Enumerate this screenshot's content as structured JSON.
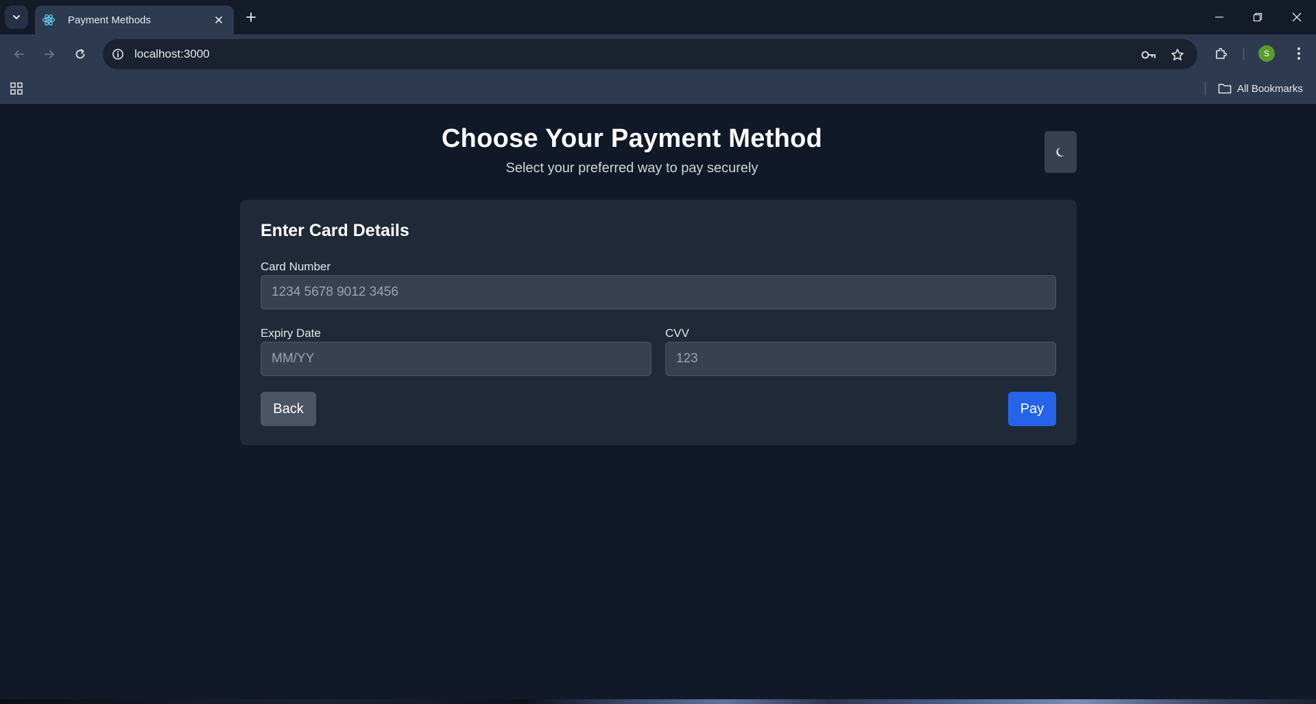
{
  "browser": {
    "tab_title": "Payment Methods",
    "url": "localhost:3000",
    "profile_initial": "S",
    "bookmarks_label": "All Bookmarks"
  },
  "page": {
    "title": "Choose Your Payment Method",
    "subtitle": "Select your preferred way to pay securely",
    "theme_toggle_icon": "moon-icon"
  },
  "card_form": {
    "heading": "Enter Card Details",
    "card_number": {
      "label": "Card Number",
      "placeholder": "1234 5678 9012 3456",
      "value": ""
    },
    "expiry": {
      "label": "Expiry Date",
      "placeholder": "MM/YY",
      "value": ""
    },
    "cvv": {
      "label": "CVV",
      "placeholder": "123",
      "value": ""
    },
    "back_label": "Back",
    "pay_label": "Pay"
  },
  "colors": {
    "page_bg": "#111827",
    "card_bg": "#1f2937",
    "input_bg": "#374151",
    "primary": "#2563eb",
    "secondary_button": "#4b5563"
  }
}
